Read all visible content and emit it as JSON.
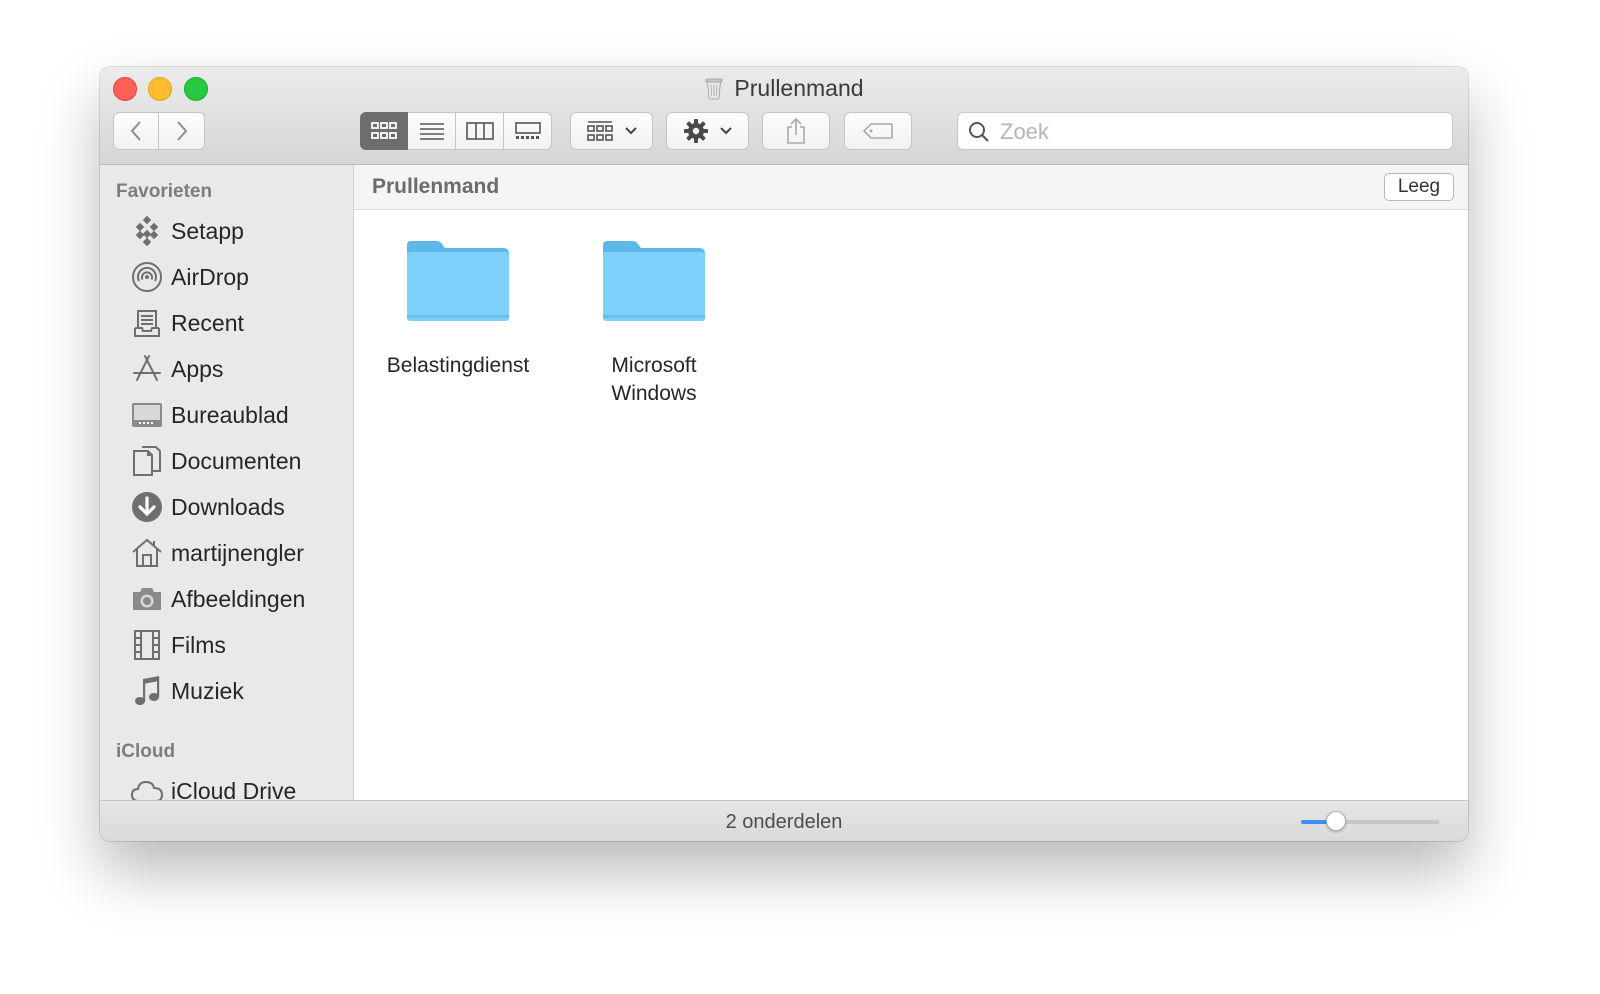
{
  "window": {
    "title": "Prullenmand"
  },
  "toolbar": {
    "view_modes": [
      {
        "icon": "icon-view-icon",
        "active": true
      },
      {
        "icon": "list-view-icon",
        "active": false
      },
      {
        "icon": "column-view-icon",
        "active": false
      },
      {
        "icon": "gallery-view-icon",
        "active": false
      }
    ],
    "group_icon": "group-by-icon",
    "action_icon": "gear-icon",
    "share_icon": "share-icon",
    "tag_icon": "tag-icon",
    "search": {
      "placeholder": "Zoek",
      "value": ""
    }
  },
  "sidebar": {
    "favorites_header": "Favorieten",
    "favorites": [
      {
        "label": "Setapp",
        "icon": "setapp-icon"
      },
      {
        "label": "AirDrop",
        "icon": "airdrop-icon"
      },
      {
        "label": "Recent",
        "icon": "recent-icon"
      },
      {
        "label": "Apps",
        "icon": "apps-icon"
      },
      {
        "label": "Bureaublad",
        "icon": "desktop-icon"
      },
      {
        "label": "Documenten",
        "icon": "documents-icon"
      },
      {
        "label": "Downloads",
        "icon": "downloads-icon"
      },
      {
        "label": "martijnengler",
        "icon": "home-icon"
      },
      {
        "label": "Afbeeldingen",
        "icon": "camera-icon"
      },
      {
        "label": "Films",
        "icon": "film-icon"
      },
      {
        "label": "Muziek",
        "icon": "music-icon"
      }
    ],
    "icloud_header": "iCloud",
    "icloud": [
      {
        "label": "iCloud Drive",
        "icon": "cloud-icon"
      }
    ]
  },
  "main": {
    "path_title": "Prullenmand",
    "empty_button": "Leeg",
    "items": [
      {
        "label": "Belastingdienst",
        "icon": "folder-icon"
      },
      {
        "label": "Microsoft Windows",
        "icon": "folder-icon"
      }
    ]
  },
  "status": {
    "count": "2 onderdelen",
    "icon_size": 0.25
  },
  "colors": {
    "folder": "#7dcff9",
    "slider_fill": "#3b8ef5",
    "active_segment": "#6d6d6d"
  }
}
